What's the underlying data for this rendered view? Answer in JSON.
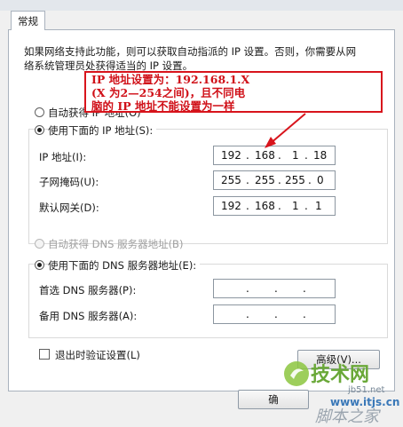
{
  "tabs": [
    "常规"
  ],
  "description": [
    "如果网络支持此功能，则可以获取自动指派的 IP 设置。否则，你需要从网",
    "络系统管理员处获得适当的 IP 设置。"
  ],
  "ip": {
    "auto_label": "自动获得 IP 地址(O)",
    "manual_label": "使用下面的 IP 地址(S):",
    "fields": [
      {
        "label": "IP 地址(I):",
        "octets": [
          "192",
          "168",
          "1",
          "18"
        ]
      },
      {
        "label": "子网掩码(U):",
        "octets": [
          "255",
          "255",
          "255",
          "0"
        ]
      },
      {
        "label": "默认网关(D):",
        "octets": [
          "192",
          "168",
          "1",
          "1"
        ]
      }
    ]
  },
  "dns": {
    "auto_label": "自动获得 DNS 服务器地址(B)",
    "manual_label": "使用下面的 DNS 服务器地址(E):",
    "fields": [
      {
        "label": "首选 DNS 服务器(P):",
        "octets": [
          "",
          "",
          "",
          ""
        ]
      },
      {
        "label": "备用 DNS 服务器(A):",
        "octets": [
          "",
          "",
          "",
          ""
        ]
      }
    ]
  },
  "validate_label": "退出时验证设置(L)",
  "advanced_button": "高级(V)...",
  "ok_button": "确",
  "callout": {
    "lines": [
      "IP 地址设置为：192.168.1.X",
      "(X 为2—254之间)，且不同电",
      "脑的 IP 地址不能设置为一样"
    ],
    "color": "#d8141c"
  },
  "watermark": {
    "brand": "技术网",
    "url": "www.itjs.cn",
    "site": "jb51.net",
    "site_cn": "脚本之家"
  }
}
